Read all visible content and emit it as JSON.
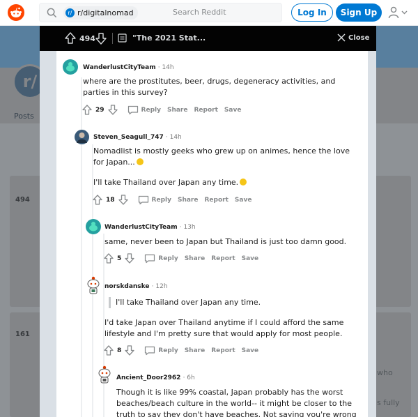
{
  "header": {
    "community_chip": "r/digitalnomad",
    "community_chip_icon": "r/",
    "search_placeholder": "Search Reddit",
    "login_label": "Log In",
    "signup_label": "Sign Up",
    "accent_color": "#0079d3",
    "brand_color": "#ff4500"
  },
  "background": {
    "avatar_letter": "r/",
    "tab_posts": "Posts",
    "post1_score": "494",
    "post2_score": "161",
    "post2_right_fragment1": "who",
    "post2_right_fragment2": "s fully"
  },
  "modal": {
    "score": "494",
    "title": "\"The 2021 Stat...",
    "close_label": "Close"
  },
  "comments": [
    {
      "author": "WanderlustCityTeam",
      "time": "· 14h",
      "text": "where are the prostitutes, beer, drugs, degeneracy activities, and parties in this survey?",
      "score": "29",
      "avatar_color": "#24a0a0",
      "actions": [
        "Reply",
        "Share",
        "Report",
        "Save"
      ]
    },
    {
      "author": "Steven_Seagull_747",
      "time": "· 14h",
      "text_p1": "Nomadlist is mostly geeks who grew up on animes, hence the love for Japan...",
      "text_p2": "I'll take Thailand over Japan any time.",
      "score": "18",
      "avatar_color": "#3a5a78",
      "actions": [
        "Reply",
        "Share",
        "Report",
        "Save"
      ]
    },
    {
      "author": "WanderlustCityTeam",
      "time": "· 13h",
      "text": "same, never been to Japan but Thailand is just too damn good.",
      "score": "5",
      "avatar_color": "#24a0a0",
      "actions": [
        "Reply",
        "Share",
        "Report",
        "Save"
      ]
    },
    {
      "author": "norskdanske",
      "time": "· 12h",
      "quote": "I'll take Thailand over Japan any time.",
      "text": "I'd take Japan over Thailand anytime if I could afford the same lifestyle and I'm pretty sure that would apply for most people.",
      "score": "8",
      "avatar_color": "#ffffff",
      "actions": [
        "Reply",
        "Share",
        "Report",
        "Save"
      ]
    },
    {
      "author": "Ancient_Door2962",
      "time": "· 6h",
      "text": "Though it is like 99% coastal, Japan probably has the worst beaches/beach culture in the world-- it might be closer to the truth to say they don't have beaches. Not saying you're wrong",
      "avatar_color": "#ffffff"
    }
  ]
}
